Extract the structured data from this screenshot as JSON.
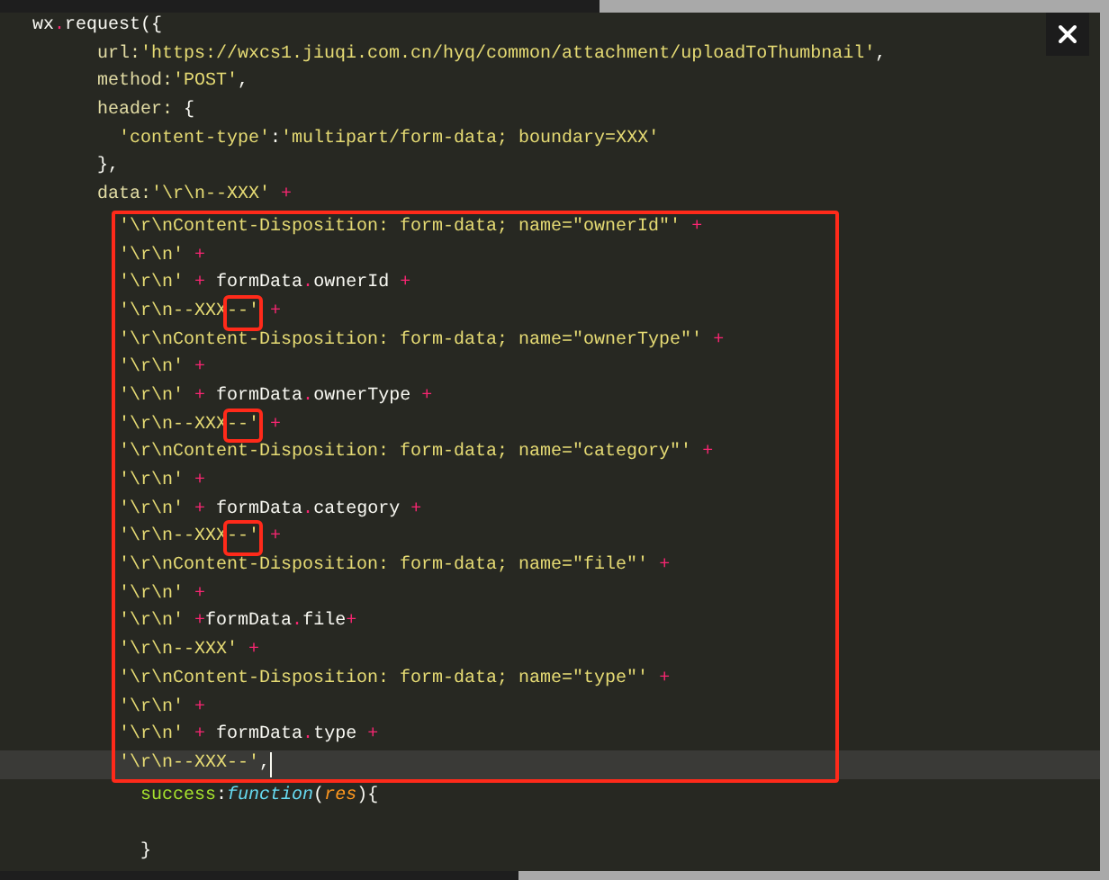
{
  "editor": {
    "lines": [
      {
        "kind": "code",
        "tokens": [
          {
            "kind": "plain",
            "text": "wx"
          },
          {
            "kind": "op",
            "text": "."
          },
          {
            "kind": "plain",
            "text": "request({"
          }
        ],
        "children": [
          {
            "kind": "code",
            "tokens": [
              {
                "kind": "key",
                "text": "url:"
              },
              {
                "kind": "string",
                "text": "'https://wxcs1.jiuqi.com.cn/hyq/common/attachment/uploadToThumbnail'"
              },
              {
                "kind": "plain",
                "text": ","
              }
            ]
          },
          {
            "kind": "code",
            "tokens": [
              {
                "kind": "key",
                "text": "method:"
              },
              {
                "kind": "string",
                "text": "'POST'"
              },
              {
                "kind": "plain",
                "text": ","
              }
            ]
          },
          {
            "kind": "code",
            "tokens": [
              {
                "kind": "key",
                "text": "header:"
              },
              {
                "kind": "plain",
                "text": " {"
              }
            ],
            "children": [
              {
                "kind": "code",
                "tokens": [
                  {
                    "kind": "string",
                    "text": "'content-type'"
                  },
                  {
                    "kind": "plain",
                    "text": ":"
                  },
                  {
                    "kind": "string",
                    "text": "'multipart/form-data; boundary=XXX'"
                  }
                ]
              }
            ]
          },
          {
            "kind": "code",
            "tokens": [
              {
                "kind": "plain",
                "text": "},"
              }
            ]
          },
          {
            "kind": "code",
            "tokens": [
              {
                "kind": "key",
                "text": "data:"
              },
              {
                "kind": "string",
                "text": "'\\r\\n--XXX'"
              },
              {
                "kind": "op",
                "text": " +"
              }
            ],
            "boxed_children": [
              {
                "kind": "code",
                "tokens": [
                  {
                    "kind": "string",
                    "text": "'\\r\\nContent-Disposition: form-data; name=\"ownerId\"'"
                  },
                  {
                    "kind": "op",
                    "text": " +"
                  }
                ]
              },
              {
                "kind": "code",
                "tokens": [
                  {
                    "kind": "string",
                    "text": "'\\r\\n'"
                  },
                  {
                    "kind": "op",
                    "text": " +"
                  }
                ]
              },
              {
                "kind": "code",
                "tokens": [
                  {
                    "kind": "string",
                    "text": "'\\r\\n'"
                  },
                  {
                    "kind": "op",
                    "text": " + "
                  },
                  {
                    "kind": "plain",
                    "text": "formData"
                  },
                  {
                    "kind": "op",
                    "text": "."
                  },
                  {
                    "kind": "plain",
                    "text": "ownerId"
                  },
                  {
                    "kind": "op",
                    "text": " +"
                  }
                ]
              },
              {
                "kind": "code",
                "tokens": [
                  {
                    "kind": "string",
                    "text": "'\\r\\n--XXX"
                  },
                  {
                    "kind": "marked",
                    "text": "--'"
                  },
                  {
                    "kind": "op",
                    "text": " +"
                  }
                ]
              },
              {
                "kind": "code",
                "tokens": [
                  {
                    "kind": "string",
                    "text": "'\\r\\nContent-Disposition: form-data; name=\"ownerType\"'"
                  },
                  {
                    "kind": "op",
                    "text": " +"
                  }
                ]
              },
              {
                "kind": "code",
                "tokens": [
                  {
                    "kind": "string",
                    "text": "'\\r\\n'"
                  },
                  {
                    "kind": "op",
                    "text": " +"
                  }
                ]
              },
              {
                "kind": "code",
                "tokens": [
                  {
                    "kind": "string",
                    "text": "'\\r\\n'"
                  },
                  {
                    "kind": "op",
                    "text": " + "
                  },
                  {
                    "kind": "plain",
                    "text": "formData"
                  },
                  {
                    "kind": "op",
                    "text": "."
                  },
                  {
                    "kind": "plain",
                    "text": "ownerType"
                  },
                  {
                    "kind": "op",
                    "text": " +"
                  }
                ]
              },
              {
                "kind": "code",
                "tokens": [
                  {
                    "kind": "string",
                    "text": "'\\r\\n--XXX"
                  },
                  {
                    "kind": "marked",
                    "text": "--'"
                  },
                  {
                    "kind": "op",
                    "text": " +"
                  }
                ]
              },
              {
                "kind": "code",
                "tokens": [
                  {
                    "kind": "string",
                    "text": "'\\r\\nContent-Disposition: form-data; name=\"category\"'"
                  },
                  {
                    "kind": "op",
                    "text": " +"
                  }
                ]
              },
              {
                "kind": "code",
                "tokens": [
                  {
                    "kind": "string",
                    "text": "'\\r\\n'"
                  },
                  {
                    "kind": "op",
                    "text": " +"
                  }
                ]
              },
              {
                "kind": "code",
                "tokens": [
                  {
                    "kind": "string",
                    "text": "'\\r\\n'"
                  },
                  {
                    "kind": "op",
                    "text": " + "
                  },
                  {
                    "kind": "plain",
                    "text": "formData"
                  },
                  {
                    "kind": "op",
                    "text": "."
                  },
                  {
                    "kind": "plain",
                    "text": "category"
                  },
                  {
                    "kind": "op",
                    "text": " +"
                  }
                ]
              },
              {
                "kind": "code",
                "tokens": [
                  {
                    "kind": "string",
                    "text": "'\\r\\n--XXX"
                  },
                  {
                    "kind": "marked",
                    "text": "--'"
                  },
                  {
                    "kind": "op",
                    "text": " +"
                  }
                ]
              },
              {
                "kind": "code",
                "tokens": [
                  {
                    "kind": "string",
                    "text": "'\\r\\nContent-Disposition: form-data; name=\"file\"'"
                  },
                  {
                    "kind": "op",
                    "text": " +"
                  }
                ]
              },
              {
                "kind": "code",
                "tokens": [
                  {
                    "kind": "string",
                    "text": "'\\r\\n'"
                  },
                  {
                    "kind": "op",
                    "text": " +"
                  }
                ]
              },
              {
                "kind": "code",
                "tokens": [
                  {
                    "kind": "string",
                    "text": "'\\r\\n'"
                  },
                  {
                    "kind": "op",
                    "text": " +"
                  },
                  {
                    "kind": "plain",
                    "text": "formData"
                  },
                  {
                    "kind": "op",
                    "text": "."
                  },
                  {
                    "kind": "plain",
                    "text": "file"
                  },
                  {
                    "kind": "op",
                    "text": "+"
                  }
                ]
              },
              {
                "kind": "code",
                "tokens": [
                  {
                    "kind": "string",
                    "text": "'\\r\\n--XXX'"
                  },
                  {
                    "kind": "op",
                    "text": " +"
                  }
                ]
              },
              {
                "kind": "code",
                "tokens": [
                  {
                    "kind": "string",
                    "text": "'\\r\\nContent-Disposition: form-data; name=\"type\"'"
                  },
                  {
                    "kind": "op",
                    "text": " +"
                  }
                ]
              },
              {
                "kind": "code",
                "tokens": [
                  {
                    "kind": "string",
                    "text": "'\\r\\n'"
                  },
                  {
                    "kind": "op",
                    "text": " +"
                  }
                ]
              },
              {
                "kind": "code",
                "tokens": [
                  {
                    "kind": "string",
                    "text": "'\\r\\n'"
                  },
                  {
                    "kind": "op",
                    "text": " + "
                  },
                  {
                    "kind": "plain",
                    "text": "formData"
                  },
                  {
                    "kind": "op",
                    "text": "."
                  },
                  {
                    "kind": "plain",
                    "text": "type"
                  },
                  {
                    "kind": "op",
                    "text": " +"
                  }
                ]
              },
              {
                "kind": "code",
                "current": true,
                "cursor": true,
                "tokens": [
                  {
                    "kind": "string",
                    "text": "'\\r\\n--XXX--'"
                  },
                  {
                    "kind": "plain",
                    "text": ","
                  }
                ]
              }
            ],
            "children": [
              {
                "kind": "code",
                "tokens": [
                  {
                    "kind": "prop",
                    "text": "success"
                  },
                  {
                    "kind": "plain",
                    "text": ":"
                  },
                  {
                    "kind": "keyword",
                    "text": "function"
                  },
                  {
                    "kind": "plain",
                    "text": "("
                  },
                  {
                    "kind": "param",
                    "text": "res"
                  },
                  {
                    "kind": "plain",
                    "text": "){"
                  }
                ]
              },
              {
                "kind": "blank"
              },
              {
                "kind": "code",
                "tokens": [
                  {
                    "kind": "plain",
                    "text": "}"
                  }
                ]
              }
            ]
          }
        ]
      }
    ]
  }
}
